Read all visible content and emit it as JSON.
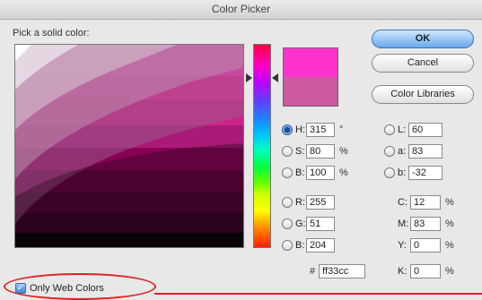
{
  "window": {
    "title": "Color Picker"
  },
  "prompt": "Pick a solid color:",
  "buttons": {
    "ok": "OK",
    "cancel": "Cancel",
    "libraries": "Color Libraries"
  },
  "colors": {
    "new": "#ff33cc",
    "old": "#cc5aa0",
    "accent": "#3a73b8",
    "highlight": "#e02020"
  },
  "hsb": [
    {
      "label": "H:",
      "value": "315",
      "unit": "°",
      "selected": true
    },
    {
      "label": "S:",
      "value": "80",
      "unit": "%",
      "selected": false
    },
    {
      "label": "B:",
      "value": "100",
      "unit": "%",
      "selected": false
    }
  ],
  "rgb": [
    {
      "label": "R:",
      "value": "255"
    },
    {
      "label": "G:",
      "value": "51"
    },
    {
      "label": "B:",
      "value": "204"
    }
  ],
  "lab": [
    {
      "label": "L:",
      "value": "60"
    },
    {
      "label": "a:",
      "value": "83"
    },
    {
      "label": "b:",
      "value": "-32"
    }
  ],
  "cmyk": [
    {
      "label": "C:",
      "value": "12",
      "unit": "%"
    },
    {
      "label": "M:",
      "value": "83",
      "unit": "%"
    },
    {
      "label": "Y:",
      "value": "0",
      "unit": "%"
    },
    {
      "label": "K:",
      "value": "0",
      "unit": "%"
    }
  ],
  "hex": {
    "label": "#",
    "value": "ff33cc"
  },
  "web_only": {
    "label": "Only Web Colors",
    "checked": true
  }
}
